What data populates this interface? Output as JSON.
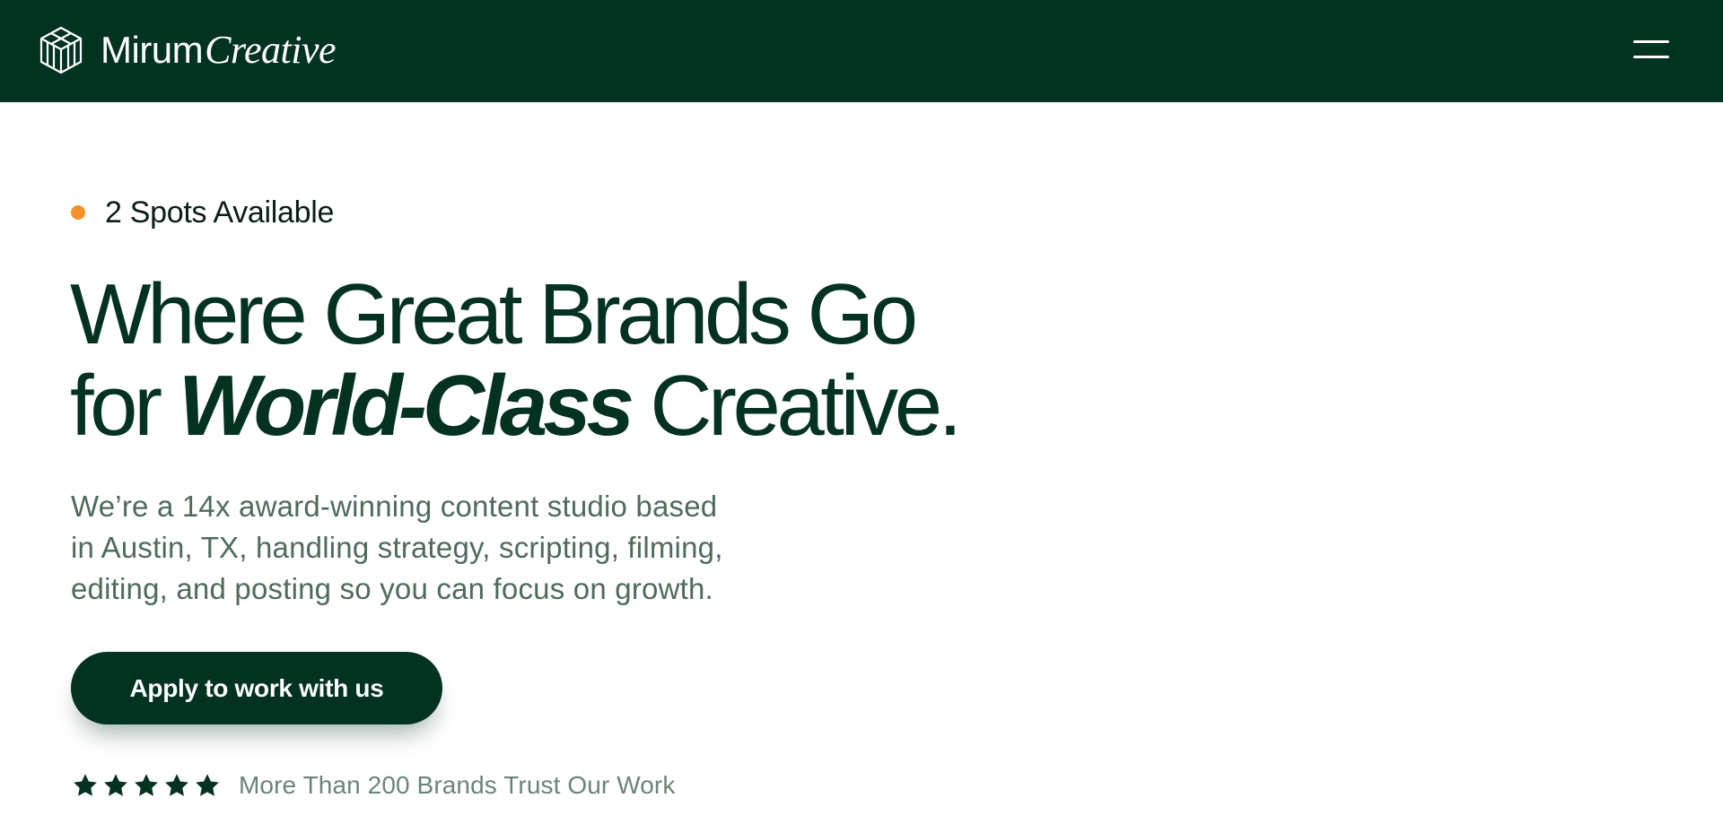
{
  "header": {
    "brand": {
      "icon": "mirum-logo-icon",
      "name_part_1": "Mirum",
      "name_part_2": "Creative"
    },
    "menu_icon": "hamburger-menu-icon"
  },
  "hero": {
    "availability": {
      "indicator_color": "#f6922c",
      "label": "2 Spots Available"
    },
    "headline": {
      "line_1": "Where Great Brands Go",
      "line_2_prefix": "for ",
      "line_2_emphasis": "World-Class",
      "line_2_suffix": " Creative."
    },
    "description": {
      "line_1": "We’re a 14x award-winning content studio based",
      "line_2": "in Austin, TX, handling strategy, scripting, filming,",
      "line_3": "editing, and posting so you can focus on growth."
    },
    "cta_label": "Apply to work with us",
    "trust": {
      "rating": 5,
      "rating_max": 5,
      "star_icon": "star-icon",
      "label": "More Than 200 Brands Trust Our Work"
    }
  },
  "colors": {
    "header_background": "#023220",
    "headline_text": "#033220",
    "body_text": "#4f6b5c",
    "accent_dot": "#f6922c",
    "button_background": "#023220",
    "button_text": "#ffffff"
  }
}
